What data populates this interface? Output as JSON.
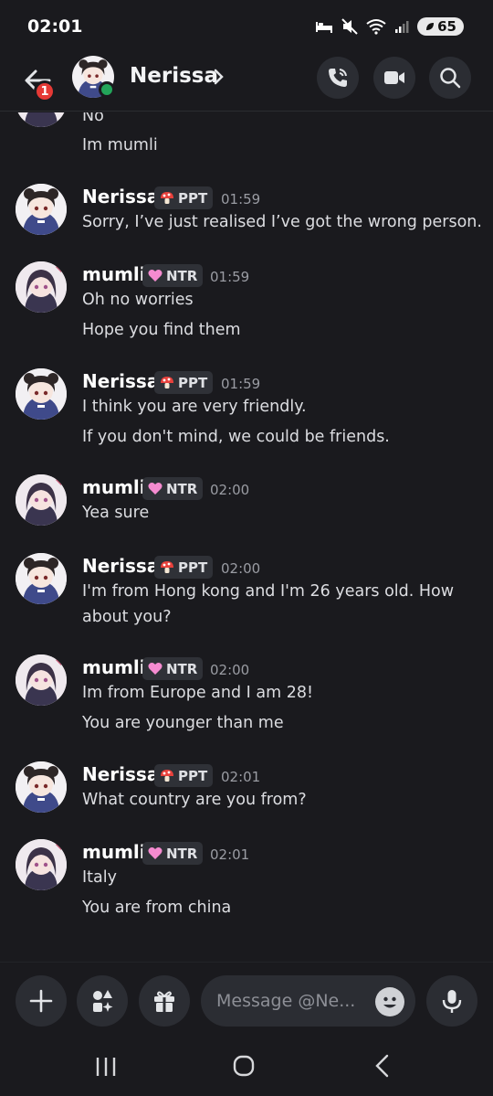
{
  "status_bar": {
    "time": "02:01",
    "battery": "65"
  },
  "header": {
    "contact_name": "Nerissa",
    "notification_count": "1"
  },
  "composer": {
    "placeholder": "Message @Ne..."
  },
  "partial_message": {
    "lines": [
      "No",
      "Im mumli"
    ]
  },
  "messages": [
    {
      "author": "Nerissa",
      "tag_icon": "mushroom",
      "tag": "PPT",
      "time": "01:59",
      "lines": [
        "Sorry, I’ve just realised I’ve got the wrong person."
      ]
    },
    {
      "author": "mumli",
      "tag_icon": "pink-heart",
      "tag": "NTR",
      "time": "01:59",
      "lines": [
        "Oh no worries",
        "Hope you find them"
      ]
    },
    {
      "author": "Nerissa",
      "tag_icon": "mushroom",
      "tag": "PPT",
      "time": "01:59",
      "lines": [
        "I think you are very friendly.",
        "If you don't mind, we could be friends."
      ]
    },
    {
      "author": "mumli",
      "tag_icon": "pink-heart",
      "tag": "NTR",
      "time": "02:00",
      "lines": [
        "Yea sure"
      ]
    },
    {
      "author": "Nerissa",
      "tag_icon": "mushroom",
      "tag": "PPT",
      "time": "02:00",
      "lines": [
        "I'm from Hong kong and I'm 26 years old. How",
        "about you?"
      ]
    },
    {
      "author": "mumli",
      "tag_icon": "pink-heart",
      "tag": "NTR",
      "time": "02:00",
      "lines": [
        "Im from Europe and I am 28!",
        "You are younger than me"
      ]
    },
    {
      "author": "Nerissa",
      "tag_icon": "mushroom",
      "tag": "PPT",
      "time": "02:01",
      "lines": [
        "What country are you from?"
      ]
    },
    {
      "author": "mumli",
      "tag_icon": "pink-heart",
      "tag": "NTR",
      "time": "02:01",
      "lines": [
        "Italy",
        "You are from china"
      ]
    }
  ],
  "colors": {
    "background": "#1a1a1e",
    "online": "#23a55a",
    "badge": "#e53935",
    "tag_bg": "#2f3137"
  },
  "icons": [
    "back-arrow-icon",
    "chevron-right-icon",
    "voice-call-icon",
    "video-call-icon",
    "search-icon",
    "plus-icon",
    "apps-icon",
    "gift-icon",
    "emoji-icon",
    "microphone-icon",
    "recent-apps-icon",
    "home-icon",
    "back-icon"
  ]
}
